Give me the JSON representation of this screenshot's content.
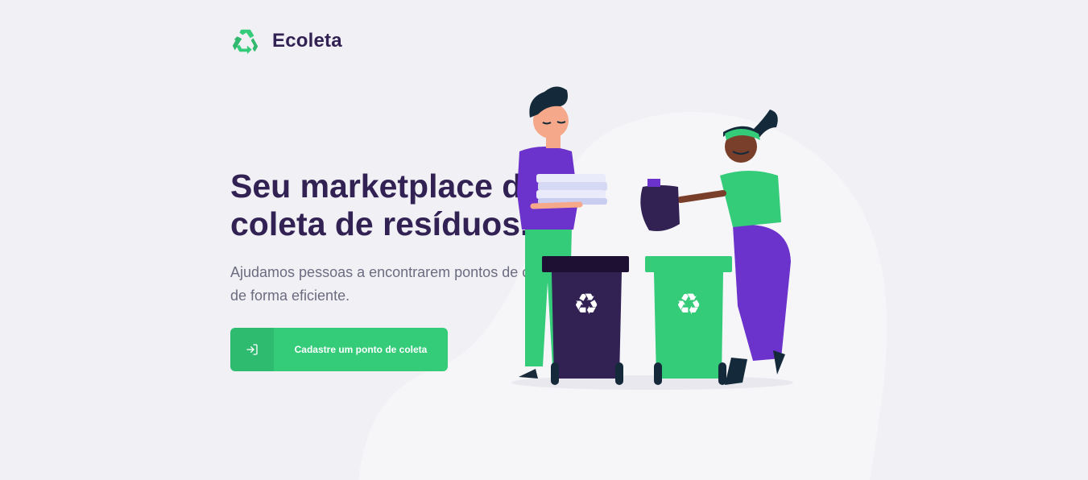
{
  "brand": {
    "name": "Ecoleta",
    "logo_icon": "recycle-icon"
  },
  "hero": {
    "title_line1": "Seu marketplace de",
    "title_line2": "coleta de resíduos.",
    "description_line1": "Ajudamos pessoas a encontrarem pontos de coleta",
    "description_line2": "de forma eficiente."
  },
  "cta": {
    "label": "Cadastre um ponto de coleta",
    "icon": "log-in-icon"
  },
  "illustration": {
    "name": "people-recycling-illustration"
  },
  "colors": {
    "background": "#f0f0f5",
    "primary": "#34cb79",
    "title": "#322153",
    "text": "#6c6c80",
    "purple": "#6c33cc"
  }
}
